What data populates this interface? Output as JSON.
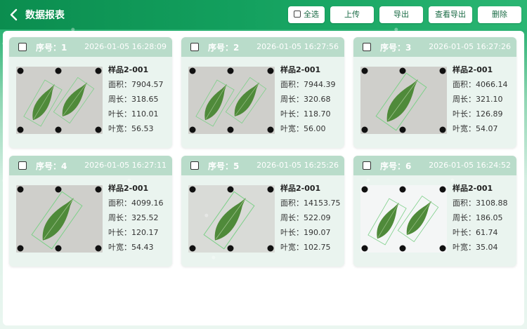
{
  "header": {
    "title": "数据报表",
    "select_all_label": "全选",
    "upload_label": "上传",
    "export_label": "导出",
    "view_export_label": "查看导出",
    "delete_label": "删除"
  },
  "labels": {
    "seq_prefix": "序号：",
    "area": "面积：",
    "perimeter": "周长：",
    "length": "叶长：",
    "width": "叶宽："
  },
  "records": [
    {
      "seq": "1",
      "time": "2026-01-05 16:28:09",
      "name": "样品2-001",
      "area": "7904.57",
      "perimeter": "318.65",
      "length": "110.01",
      "width": "56.53",
      "leaves": 2,
      "bg": "#cfcfcb"
    },
    {
      "seq": "2",
      "time": "2026-01-05 16:27:56",
      "name": "样品2-001",
      "area": "7944.39",
      "perimeter": "320.68",
      "length": "118.70",
      "width": "56.00",
      "leaves": 2,
      "bg": "#cfcfcb"
    },
    {
      "seq": "3",
      "time": "2026-01-05 16:27:26",
      "name": "样品2-001",
      "area": "4066.14",
      "perimeter": "321.10",
      "length": "126.89",
      "width": "54.07",
      "leaves": 1,
      "bg": "#cfcfcb"
    },
    {
      "seq": "4",
      "time": "2026-01-05 16:27:11",
      "name": "样品2-001",
      "area": "4099.16",
      "perimeter": "325.52",
      "length": "120.17",
      "width": "54.43",
      "leaves": 1,
      "bg": "#cfcfcb"
    },
    {
      "seq": "5",
      "time": "2026-01-05 16:25:26",
      "name": "样品2-001",
      "area": "14153.75",
      "perimeter": "522.09",
      "length": "190.07",
      "width": "102.75",
      "leaves": 1,
      "bg": "#d9dbd7"
    },
    {
      "seq": "6",
      "time": "2026-01-05 16:24:52",
      "name": "样品2-001",
      "area": "3108.88",
      "perimeter": "186.05",
      "length": "61.74",
      "width": "35.04",
      "leaves": 2,
      "bg": "#f4f6f6"
    }
  ],
  "colors": {
    "header": "#13a05e",
    "card_head": "#b9dcca",
    "card_body": "#eaf4ef",
    "leaf": "#4f8a3a"
  },
  "icons": {
    "back": "chevron-left-icon",
    "checkbox": "checkbox-icon"
  }
}
